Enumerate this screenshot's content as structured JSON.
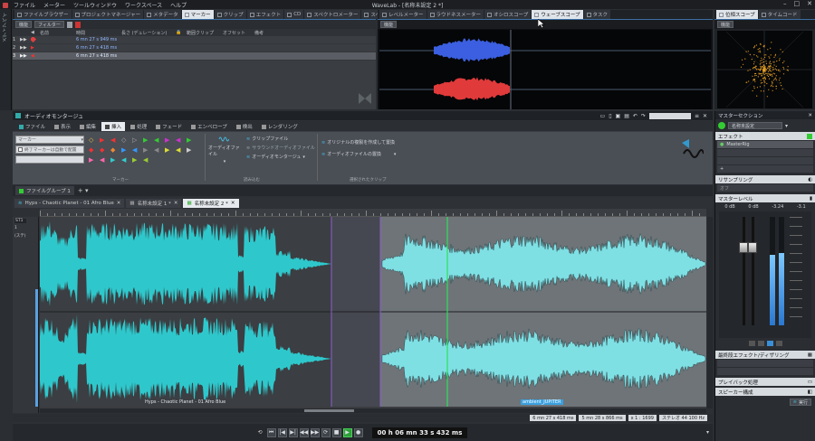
{
  "titlebar": {
    "title": "WaveLab - [名称未設定 2 *]",
    "menu": [
      "ファイル",
      "メーター",
      "ツールウィンドウ",
      "ワークスペース",
      "ヘルプ"
    ]
  },
  "leftstrip": {
    "label": "メディアベイ"
  },
  "marker_panel": {
    "tabs": [
      "ファイルブラウザー",
      "プロジェクトマネージャー",
      "メタデータ",
      "マーカー",
      "クリップ",
      "エフェクト",
      "CD",
      "スペクトロメーター",
      "スペクトログラフ"
    ],
    "active_tab": "マーカー",
    "toolbar": {
      "function": "機能",
      "filter": "フィルター"
    },
    "headers": [
      "名前",
      "時間",
      "長さ (デュレーション)",
      "範囲クリップ",
      "オフセット",
      "備考"
    ],
    "rows": [
      {
        "num": "1",
        "time": "6 mn 27 s 949 ms"
      },
      {
        "num": "2",
        "time": "6 mn 27 s 418 ms"
      },
      {
        "num": "3",
        "time": "6 mn 27 s 418 ms"
      }
    ]
  },
  "scope_panel": {
    "tabs": [
      "レベルメーター",
      "ラウドネスメーター",
      "オシロスコープ",
      "ウェーブスコープ",
      "タスク"
    ],
    "active_tab": "ウェーブスコープ",
    "function": "機能"
  },
  "phase_panel": {
    "tabs": [
      "位相スコープ",
      "タイムコード"
    ],
    "active_tab": "位相スコープ",
    "function": "機能"
  },
  "montage": {
    "title": "オーディオモンタージュ",
    "ribbon_tabs": [
      "ファイル",
      "表示",
      "編集",
      "挿入",
      "処理",
      "フェード",
      "エンベロープ",
      "検出",
      "レンダリング"
    ],
    "active_ribbon_tab": "挿入",
    "marker_combo": "マーカー",
    "marker_checkbox": "終了マーカーは自動で配置",
    "group_labels": {
      "markers": "マーカー",
      "import": "読み込む",
      "replace": "選択されたクリップ"
    },
    "audio_file_label": "オーディオファイル",
    "import_items": [
      "クリップファイル",
      "サラウンドオーディオファイル",
      "オーディオモンタージュ"
    ],
    "replace_items": [
      "オリジナルの複製を作成して置換",
      "オーディオファイルの置換"
    ],
    "file_group": "ファイルグループ 1",
    "tabs": [
      "Hyps - Chaotic Planet - 01 Afro Blue",
      "名称未設定 1 *",
      "名称未設定 2 *"
    ],
    "active_tab": "名称未設定 2 *",
    "track_label": "1 (ステ",
    "track_meta": [
      "ST1",
      "1",
      "(ステ)"
    ],
    "clip1_name": "Hyps - Chaotic Planet - 01 Afro Blue",
    "clip2_name": "ambient_JUPITER",
    "status": [
      "6 mn 27 s 418 ms",
      "5 mn 28 s 866 ms",
      "x 1 : 1699",
      "ステレオ 44 100 Hz"
    ],
    "timecode": "00 h 06 mn 33 s 432 ms"
  },
  "master": {
    "title": "マスターセクション",
    "preset": "名称未設定",
    "effects_label": "エフェクト",
    "effect_slot": "MasterRig",
    "resampling": "リサンプリング",
    "resampling_value": "オフ",
    "master_level": "マスターレベル",
    "levels": [
      "0 dB",
      "0 dB",
      "-3.24",
      "-3.1"
    ],
    "final_effects": "最終段エフェクト/ディザリング",
    "playback": "プレイバック処理",
    "speaker": "スピーカー構成",
    "render": "実行"
  },
  "colors": {
    "waveform": "#2ec8cc",
    "clip_bg": "#3e4246",
    "scope_blue": "#3b5fe0",
    "scope_red": "#e03a3a",
    "accent": "#3a6ea5"
  }
}
